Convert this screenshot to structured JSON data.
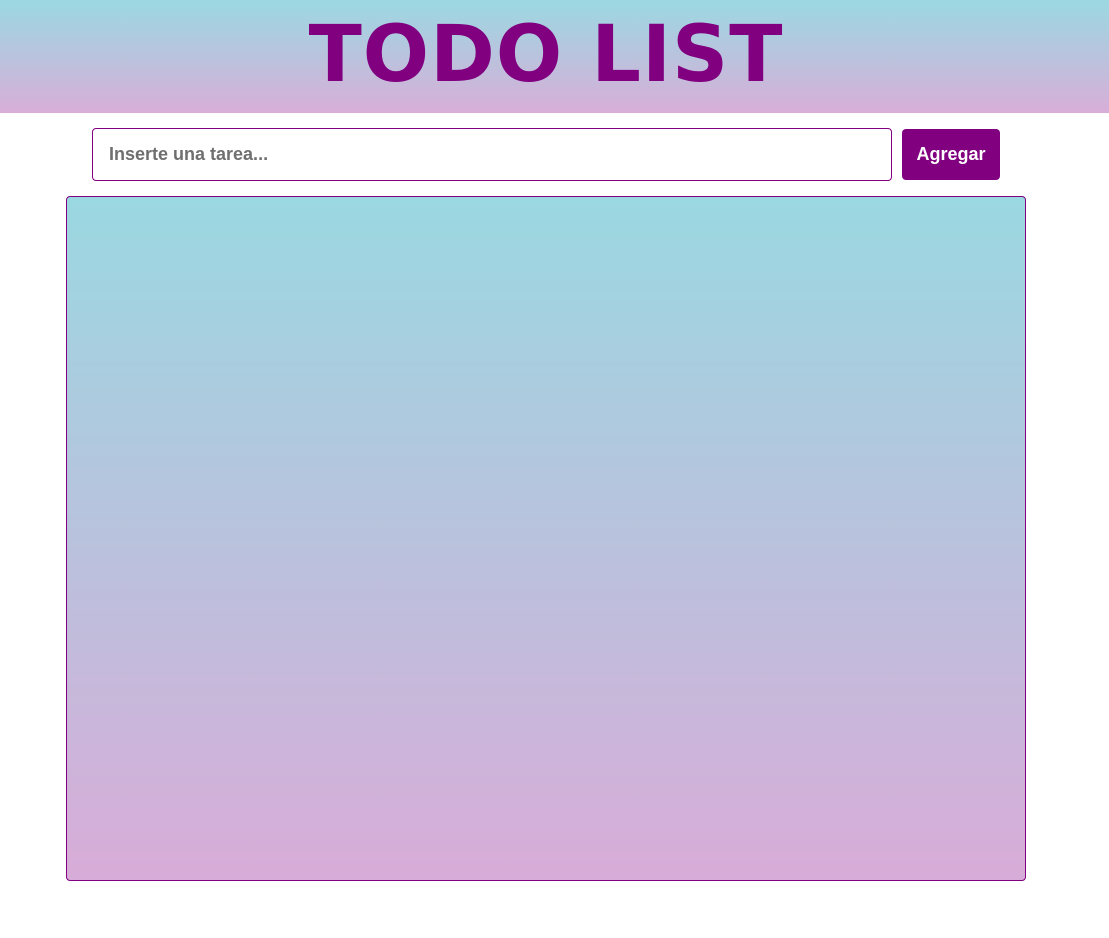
{
  "header": {
    "title": "TODO LIST"
  },
  "form": {
    "input_value": "",
    "input_placeholder": "Inserte una tarea...",
    "add_label": "Agregar"
  },
  "task_list": {
    "items": []
  },
  "colors": {
    "accent": "#800080",
    "gradient_top": "#9bd8e2",
    "gradient_bottom": "#d8aed8"
  }
}
